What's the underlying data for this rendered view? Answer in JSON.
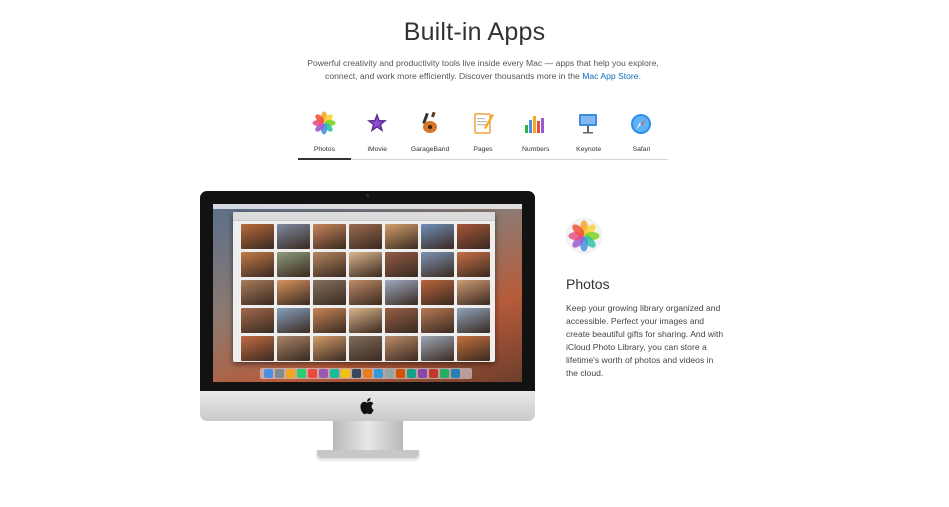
{
  "page": {
    "title": "Built-in Apps",
    "intro_text": "Powerful creativity and productivity tools live inside every Mac — apps that help you explore, connect, and work more efficiently. Discover thousands more in the ",
    "intro_link": "Mac App Store",
    "intro_end": "."
  },
  "tabs": [
    {
      "label": "Photos",
      "icon": "photos-icon",
      "active": true
    },
    {
      "label": "iMovie",
      "icon": "imovie-icon",
      "active": false
    },
    {
      "label": "GarageBand",
      "icon": "garageband-icon",
      "active": false
    },
    {
      "label": "Pages",
      "icon": "pages-icon",
      "active": false
    },
    {
      "label": "Numbers",
      "icon": "numbers-icon",
      "active": false
    },
    {
      "label": "Keynote",
      "icon": "keynote-icon",
      "active": false
    },
    {
      "label": "Safari",
      "icon": "safari-icon",
      "active": false
    }
  ],
  "detail": {
    "title": "Photos",
    "body": "Keep your growing library organized and accessible. Perfect your images and create beautiful gifts for sharing. And with iCloud Photo Library, you can store a lifetime's worth of photos and videos in the cloud."
  },
  "colors": {
    "link": "#0b6bc2",
    "text": "#333333",
    "thumbs": [
      "#b96a3e",
      "#7e8aa1",
      "#c9855a",
      "#9a6b4f",
      "#d4a06c",
      "#6f8fb8",
      "#a5563a",
      "#c37a4a",
      "#8d9b7a",
      "#b5855f",
      "#d9b58c",
      "#925c44",
      "#7c93b3",
      "#c66f45",
      "#a97b5a",
      "#d69360",
      "#85705e",
      "#bf8a66",
      "#9eaac0",
      "#b9643d",
      "#cc9a72",
      "#a46a4c",
      "#87a0bd",
      "#c98556",
      "#dbb38a",
      "#975f45",
      "#b87a55",
      "#8fa3b9",
      "#c46b43",
      "#a88467",
      "#d49c6a",
      "#7f6c5c",
      "#bd8d69",
      "#9da7b8",
      "#c4703f"
    ]
  }
}
